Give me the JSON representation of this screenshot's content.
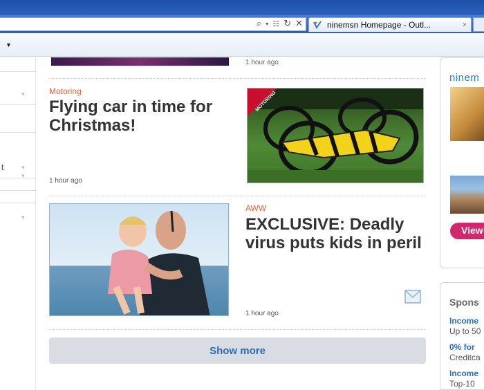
{
  "browser": {
    "tab_title": "ninemsn Homepage - Outl...",
    "tab_close": "×",
    "address_icons": [
      "search-icon",
      "dropdown-icon",
      "compat-icon",
      "refresh-icon",
      "stop-icon"
    ]
  },
  "feed": {
    "top_time": "1 hour ago",
    "articles": [
      {
        "category": "Motoring",
        "headline": "Flying car in time for Christmas!",
        "time": "1 hour ago",
        "image_badge": "MOTORING"
      },
      {
        "category": "AWW",
        "headline": "EXCLUSIVE: Deadly virus puts kids in peril",
        "time": "1 hour ago"
      }
    ],
    "show_more": "Show more"
  },
  "sidebar_left": {
    "rows": [
      "t"
    ]
  },
  "right_col": {
    "brand": "ninem",
    "view_button": "View",
    "sponsor_heading": "Spons",
    "sponsored": [
      {
        "title": "Income",
        "text": "Up to 50"
      },
      {
        "title": "0% for",
        "text": "Creditca"
      },
      {
        "title": "Income",
        "text": "Top-10"
      }
    ]
  },
  "colors": {
    "category": "#e2623a",
    "headline": "#333333",
    "link": "#2b6bb5",
    "view_button": "#d3276d",
    "show_more_bg": "#d9dde3"
  }
}
